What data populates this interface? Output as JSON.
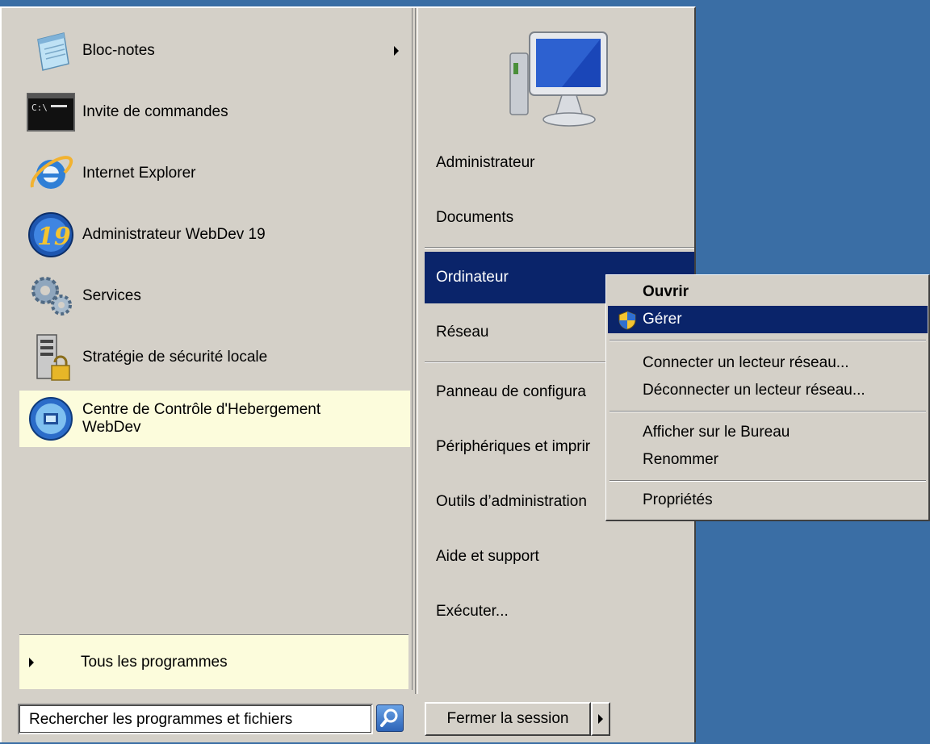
{
  "programs": [
    {
      "label": "Bloc-notes",
      "icon": "notepad-icon",
      "has_submenu": true
    },
    {
      "label": "Invite de commandes",
      "icon": "cmd-icon"
    },
    {
      "label": "Internet Explorer",
      "icon": "ie-icon"
    },
    {
      "label": "Administrateur WebDev 19",
      "icon": "webdev-19-icon"
    },
    {
      "label": "Services",
      "icon": "gears-icon"
    },
    {
      "label": "Stratégie de sécurité locale",
      "icon": "security-policy-icon"
    },
    {
      "label_line1": "Centre de Contrôle d'Hebergement",
      "label_line2": "WebDev",
      "icon": "webdev-hosting-icon",
      "highlighted": true
    }
  ],
  "all_programs": "Tous les programmes",
  "search": {
    "placeholder": "Rechercher les programmes et fichiers"
  },
  "right_items": [
    {
      "label": "Administrateur"
    },
    {
      "label": "Documents"
    },
    {
      "label": "Ordinateur",
      "selected": true
    },
    {
      "label": "Réseau"
    },
    {
      "label": "Panneau de configura"
    },
    {
      "label": "Périphériques et imprir"
    },
    {
      "label": "Outils d’administration"
    },
    {
      "label": "Aide et support"
    },
    {
      "label": "Exécuter..."
    }
  ],
  "shutdown": {
    "label": "Fermer la session"
  },
  "context_menu": [
    {
      "label": "Ouvrir",
      "bold": true
    },
    {
      "label": "Gérer",
      "selected": true,
      "icon": "uac-shield-icon"
    },
    {
      "label": "Connecter un lecteur réseau..."
    },
    {
      "label": "Déconnecter un lecteur réseau..."
    },
    {
      "label": "Afficher sur le Bureau"
    },
    {
      "label": "Renommer"
    },
    {
      "label": "Propriétés"
    }
  ],
  "colors": {
    "desktop": "#3a6ea5",
    "menu_bg": "#d4d0c8",
    "selection": "#0a246a",
    "highlight": "#fcfcdc"
  }
}
